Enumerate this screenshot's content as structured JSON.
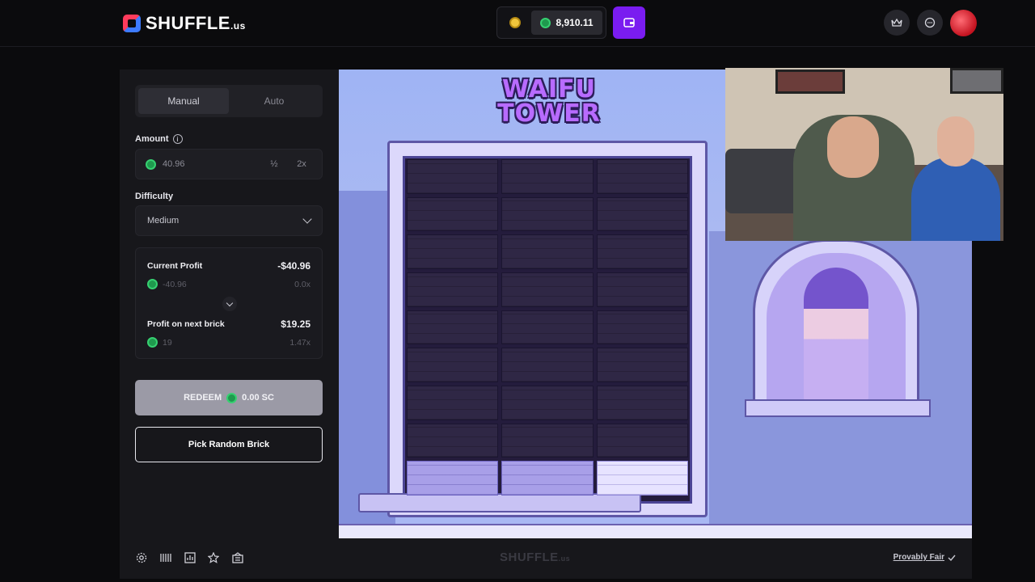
{
  "header": {
    "logo_main": "SHUFFLE",
    "logo_suffix": ".us",
    "balance": "8,910.11"
  },
  "panel": {
    "tabs": [
      {
        "label": "Manual",
        "active": true
      },
      {
        "label": "Auto",
        "active": false
      }
    ],
    "amount": {
      "label": "Amount",
      "value": "40.96",
      "half_label": "½",
      "double_label": "2x"
    },
    "difficulty": {
      "label": "Difficulty",
      "selected": "Medium"
    },
    "current_profit": {
      "title": "Current Profit",
      "value": "-$40.96",
      "coins": "-40.96",
      "multiplier": "0.0x"
    },
    "next_profit": {
      "title": "Profit on next brick",
      "value": "$19.25",
      "coins": "19",
      "multiplier": "1.47x"
    },
    "redeem": {
      "label": "REDEEM",
      "amount": "0.00 SC"
    },
    "random_label": "Pick Random Brick"
  },
  "game": {
    "title_line1": "WAIFU",
    "title_line2": "TOWER",
    "rows": 9,
    "cols": 3,
    "active_rows_from_bottom": 1,
    "highlighted_col": 2
  },
  "footer": {
    "logo_main": "SHUFFLE",
    "logo_suffix": ".us",
    "provably_fair": "Provably Fair"
  },
  "colors": {
    "accent_purple": "#7a1cf0",
    "coin_green": "#36d071",
    "coin_gold": "#f0c53c"
  }
}
